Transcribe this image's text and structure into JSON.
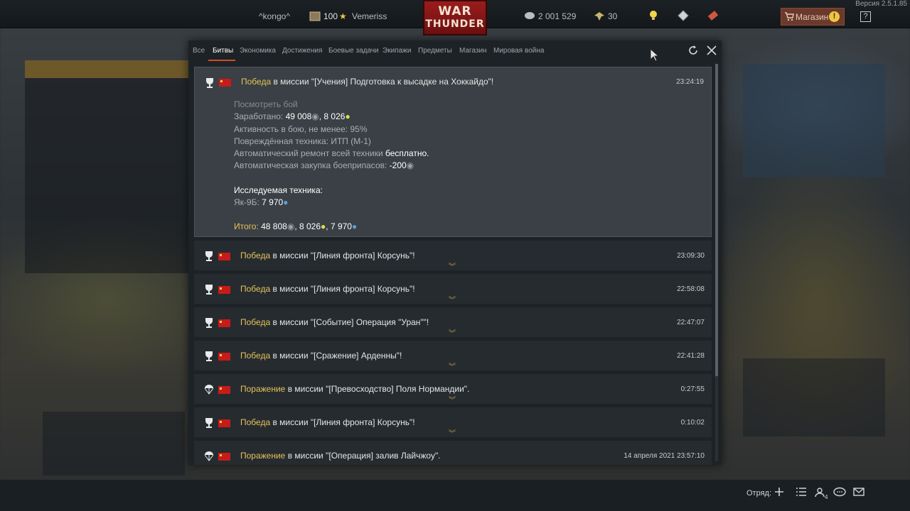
{
  "version": "Версия 2.5.1.85",
  "topbar": {
    "player_name": "^kongo^",
    "clan_count": "100",
    "clan_name": "Vemeriss",
    "logo_line1": "WAR",
    "logo_line2": "THUNDER",
    "silver": "2 001 529",
    "gold": "30",
    "shop_label": "Магазин",
    "shop_alert": "!",
    "help_label": "?"
  },
  "tabs": [
    {
      "label": "Все"
    },
    {
      "label": "Битвы",
      "active": true
    },
    {
      "label": "Экономика"
    },
    {
      "label": "Достижения"
    },
    {
      "label": "Боевые задачи"
    },
    {
      "label": "Экипажи"
    },
    {
      "label": "Предметы"
    },
    {
      "label": "Магазин"
    },
    {
      "label": "Мировая война"
    }
  ],
  "expanded_entry": {
    "result": "Победа",
    "text": " в миссии \"[Учения] Подготовка к высадке на Хоккайдо\"!",
    "time": "23:24:19",
    "view_battle": "Посмотреть бой",
    "earned_label": "Заработано: ",
    "earned_value": "49 008",
    "earned_rp": "8 026",
    "activity_label": "Активность в бою, не менее: ",
    "activity_value": "95%",
    "damaged_label": "Повреждённая техника: ",
    "damaged_value": "ИТП (М-1)",
    "repair_label": "Автоматический ремонт всей техники ",
    "repair_value": "бесплатно.",
    "ammo_label": "Автоматическая закупка боеприпасов: ",
    "ammo_value": "-200",
    "research_label": "Исследуемая техника:",
    "research_vehicle": "Як-9Б: ",
    "research_value": "7 970",
    "total_label": "Итого: ",
    "total_silver": "48 808",
    "total_rp": "8 026",
    "total_research": "7 970"
  },
  "entries": [
    {
      "result": "Победа",
      "text": " в миссии \"[Линия фронта] Корсунь\"!",
      "time": "23:09:30",
      "icon": "trophy"
    },
    {
      "result": "Победа",
      "text": " в миссии \"[Линия фронта] Корсунь\"!",
      "time": "22:58:08",
      "icon": "trophy"
    },
    {
      "result": "Победа",
      "text": " в миссии \"[Событие] Операция \"Уран\"\"!",
      "time": "22:47:07",
      "icon": "trophy"
    },
    {
      "result": "Победа",
      "text": " в миссии \"[Сражение] Арденны\"!",
      "time": "22:41:28",
      "icon": "trophy"
    },
    {
      "result": "Поражение",
      "text": " в миссии \"[Превосходство] Поля Нормандии\".",
      "time": "0:27:55",
      "icon": "parachute"
    },
    {
      "result": "Победа",
      "text": " в миссии \"[Линия фронта] Корсунь\"!",
      "time": "0:10:02",
      "icon": "trophy"
    },
    {
      "result": "Поражение",
      "text": " в миссии \"[Операция] залив Лайчжоу\".",
      "time": "14 апреля 2021 23:57:10",
      "icon": "parachute"
    }
  ],
  "bottombar": {
    "squad_label": "Отряд:",
    "friends_count": "4"
  },
  "colors": {
    "accent_red": "#d34a2e",
    "result_gold": "#e5c25a",
    "flag_red": "#c71b1b"
  }
}
